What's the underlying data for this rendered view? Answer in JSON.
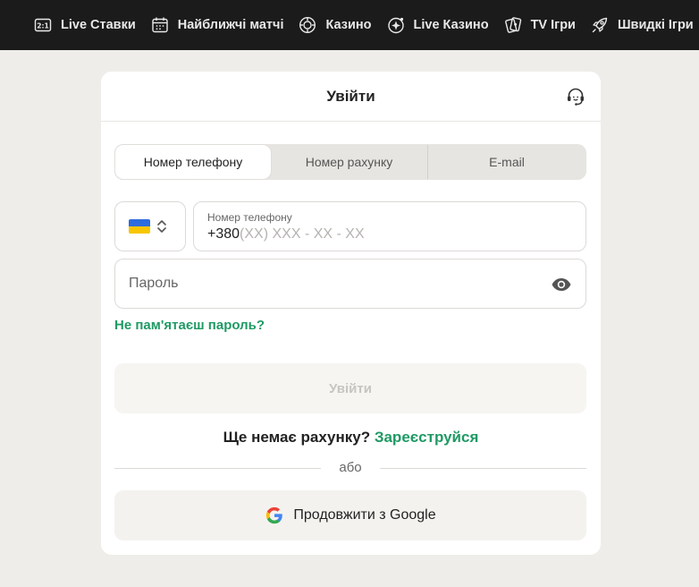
{
  "nav": {
    "items": [
      {
        "label": "Live Ставки",
        "icon": "live-score-icon"
      },
      {
        "label": "Найближчі матчі",
        "icon": "calendar-icon"
      },
      {
        "label": "Казино",
        "icon": "casino-chip-icon"
      },
      {
        "label": "Live Казино",
        "icon": "live-casino-icon"
      },
      {
        "label": "TV Ігри",
        "icon": "cards-icon"
      },
      {
        "label": "Швидкі Ігри",
        "icon": "rocket-icon"
      }
    ]
  },
  "login": {
    "title": "Увійти",
    "tabs": [
      "Номер телефону",
      "Номер рахунку",
      "E-mail"
    ],
    "active_tab": "Номер телефону",
    "country_flag": "flag-ukraine-icon",
    "phone_label": "Номер телефону",
    "phone_prefix": "+380",
    "phone_mask": "(XX) XXX - XX - XX",
    "password_placeholder": "Пароль",
    "forgot_password": "Не пам'ятаєш пароль?",
    "submit_label": "Увійти",
    "no_account_text": "Ще немає рахунку?",
    "register_link": "Зареєструйся",
    "or_text": "або",
    "google_label": "Продовжити з Google"
  },
  "colors": {
    "accent_green": "#1f9a64",
    "topnav_bg": "#1b1b1b",
    "page_bg": "#efedea"
  }
}
